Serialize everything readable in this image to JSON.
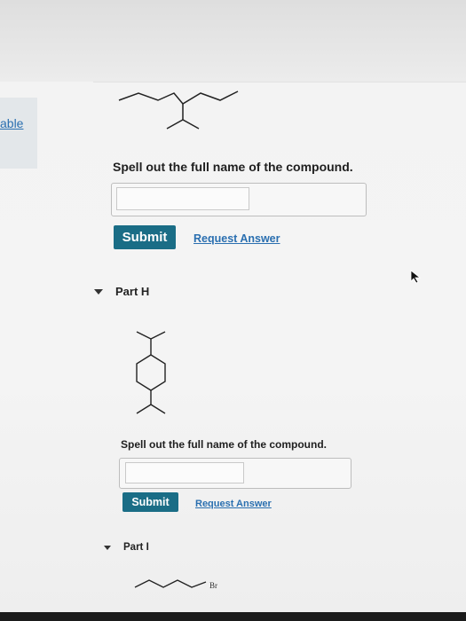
{
  "sidebar": {
    "tab_label": "able"
  },
  "question_g": {
    "prompt": "Spell out the full name of the compound.",
    "answer_value": "",
    "submit_label": "Submit",
    "request_answer_label": "Request Answer"
  },
  "part_h": {
    "label": "Part H",
    "prompt": "Spell out the full name of the compound.",
    "answer_value": "",
    "submit_label": "Submit",
    "request_answer_label": "Request Answer"
  },
  "part_i": {
    "label": "Part I",
    "structure_atom_label": "Br"
  },
  "colors": {
    "submit_bg": "#1a6d86",
    "link": "#2a6fb0"
  },
  "icons": [
    "disclosure-triangle-icon",
    "mouse-cursor-icon"
  ]
}
